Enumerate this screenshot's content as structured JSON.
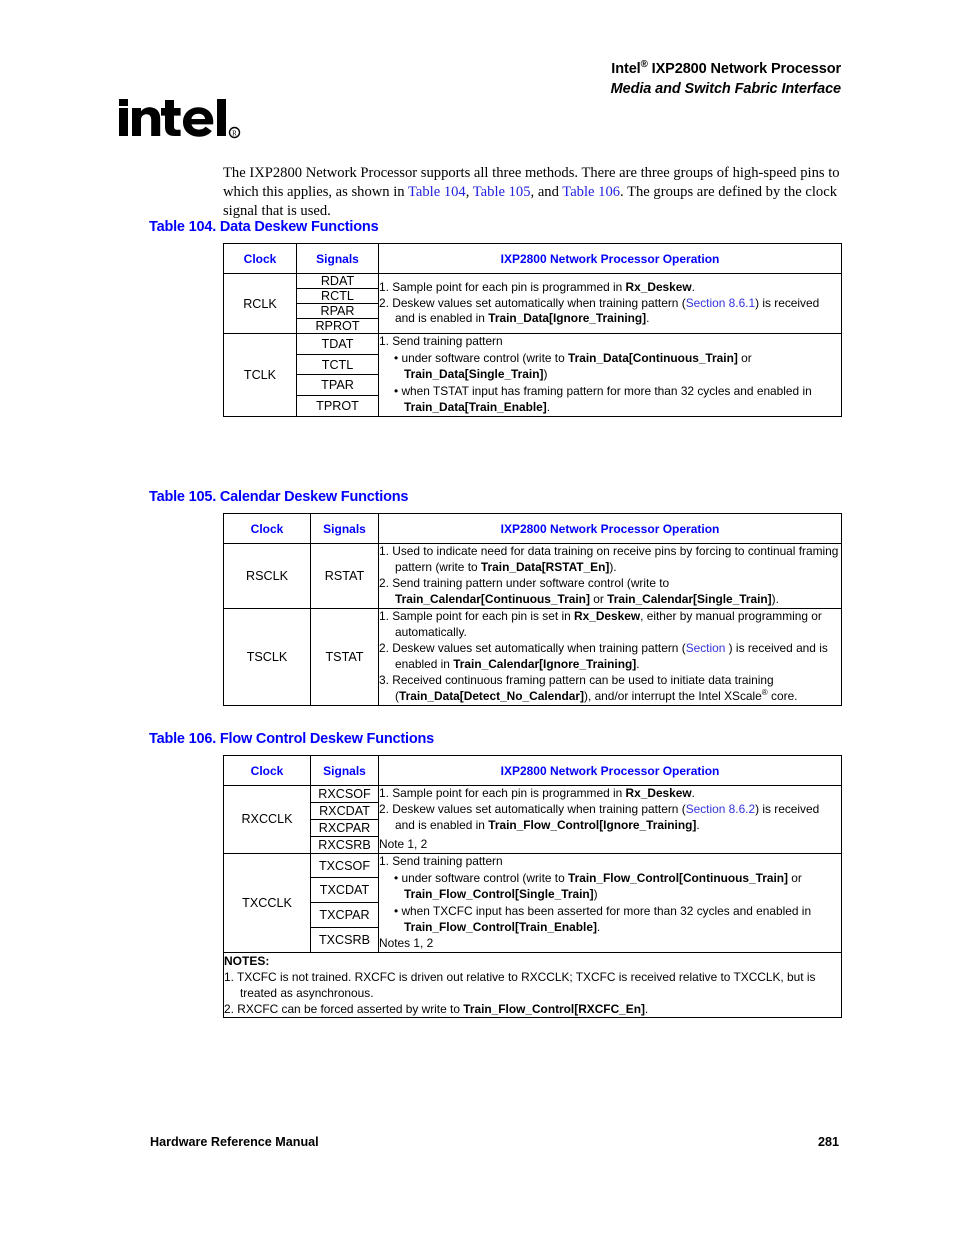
{
  "header": {
    "line1_pre": "Intel",
    "line1_sup": "®",
    "line1_post": " IXP2800 Network Processor",
    "line2": "Media and Switch Fabric Interface",
    "logo_alt": "intel-logo"
  },
  "intro": {
    "seg1": "The IXP2800 Network Processor supports all three methods. There are three groups of high-speed pins to which this applies, as shown in ",
    "link1": "Table 104",
    "sep1": ", ",
    "link2": "Table 105",
    "sep2": ", and ",
    "link3": "Table 106",
    "seg2": ". The groups are defined by the clock signal that is used."
  },
  "columns": {
    "clock": "Clock",
    "signals": "Signals",
    "operation": "IXP2800 Network Processor Operation"
  },
  "table104": {
    "caption": "Table 104. Data Deskew Functions",
    "rows": [
      {
        "clock": "RCLK",
        "signals": [
          "RDAT",
          "RCTL",
          "RPAR",
          "RPROT"
        ],
        "ops": [
          {
            "kind": "num",
            "num": "1.",
            "parts": [
              {
                "t": "Sample point for each pin is programmed in "
              },
              {
                "t": "Rx_Deskew",
                "b": true
              },
              {
                "t": "."
              }
            ]
          },
          {
            "kind": "num",
            "num": "2.",
            "parts": [
              {
                "t": "Deskew values set automatically when training pattern ("
              },
              {
                "t": "Section 8.6.1",
                "link": true
              },
              {
                "t": ") is received and is enabled in "
              },
              {
                "t": "Train_Data[Ignore_Training]",
                "b": true
              },
              {
                "t": "."
              }
            ]
          }
        ]
      },
      {
        "clock": "TCLK",
        "signals": [
          "TDAT",
          "TCTL",
          "TPAR",
          "TPROT"
        ],
        "ops": [
          {
            "kind": "num",
            "num": "1.",
            "parts": [
              {
                "t": "Send training pattern"
              }
            ]
          },
          {
            "kind": "bullet",
            "num": "•",
            "parts": [
              {
                "t": "under software control (write to "
              },
              {
                "t": "Train_Data[Continuous_Train]",
                "b": true
              },
              {
                "t": " or "
              },
              {
                "t": "Train_Data[Single_Train]",
                "b": true
              },
              {
                "t": ")"
              }
            ]
          },
          {
            "kind": "bullet",
            "num": "•",
            "parts": [
              {
                "t": "when TSTAT input has framing pattern for more than 32 cycles and enabled in "
              },
              {
                "t": "Train_Data[Train_Enable]",
                "b": true
              },
              {
                "t": "."
              }
            ]
          }
        ]
      }
    ]
  },
  "table105": {
    "caption": "Table 105. Calendar Deskew Functions",
    "rows": [
      {
        "clock": "RSCLK",
        "signals": [
          "RSTAT"
        ],
        "ops": [
          {
            "kind": "num",
            "num": "1.",
            "parts": [
              {
                "t": "Used to indicate need for data training on receive pins by forcing to continual framing pattern (write to "
              },
              {
                "t": "Train_Data[RSTAT_En]",
                "b": true
              },
              {
                "t": ")."
              }
            ]
          },
          {
            "kind": "num",
            "num": "2.",
            "parts": [
              {
                "t": "Send training pattern under software control (write to "
              },
              {
                "t": "Train_Calendar[Continuous_Train]",
                "b": true
              },
              {
                "t": " or "
              },
              {
                "t": "Train_Calendar[Single_Train]",
                "b": true
              },
              {
                "t": ")."
              }
            ]
          }
        ]
      },
      {
        "clock": "TSCLK",
        "signals": [
          "TSTAT"
        ],
        "ops": [
          {
            "kind": "num",
            "num": "1.",
            "parts": [
              {
                "t": "Sample point for each pin is set in "
              },
              {
                "t": "Rx_Deskew",
                "b": true
              },
              {
                "t": ", either by manual programming or automatically."
              }
            ]
          },
          {
            "kind": "num",
            "num": "2.",
            "parts": [
              {
                "t": "Deskew values set automatically when training pattern ("
              },
              {
                "t": "Section",
                "link": true
              },
              {
                "t": " ) is received and is enabled in "
              },
              {
                "t": "Train_Calendar[Ignore_Training]",
                "b": true
              },
              {
                "t": "."
              }
            ]
          },
          {
            "kind": "num",
            "num": "3.",
            "parts": [
              {
                "t": "Received continuous framing pattern can be used to initiate data training ("
              },
              {
                "t": "Train_Data[Detect_No_Calendar]",
                "b": true
              },
              {
                "t": "), and/or interrupt the Intel XScale"
              },
              {
                "t": "®",
                "sup": true
              },
              {
                "t": " core."
              }
            ]
          }
        ]
      }
    ]
  },
  "table106": {
    "caption": "Table 106. Flow Control Deskew Functions",
    "rows": [
      {
        "clock": "RXCCLK",
        "signals": [
          "RXCSOF",
          "RXCDAT",
          "RXCPAR",
          "RXCSRB"
        ],
        "ops": [
          {
            "kind": "num",
            "num": "1.",
            "parts": [
              {
                "t": "Sample point for each pin is programmed in "
              },
              {
                "t": "Rx_Deskew",
                "b": true
              },
              {
                "t": "."
              }
            ]
          },
          {
            "kind": "num",
            "num": "2.",
            "parts": [
              {
                "t": "Deskew values set automatically when training pattern ("
              },
              {
                "t": "Section 8.6.2",
                "link": true
              },
              {
                "t": ") is received and is enabled in "
              },
              {
                "t": "Train_Flow_Control[Ignore_Training]",
                "b": true
              },
              {
                "t": "."
              }
            ]
          },
          {
            "kind": "plain",
            "gap": true,
            "parts": [
              {
                "t": "Note 1, 2"
              }
            ]
          }
        ]
      },
      {
        "clock": "TXCCLK",
        "signals": [
          "TXCSOF",
          "TXCDAT",
          "TXCPAR",
          "TXCSRB"
        ],
        "ops": [
          {
            "kind": "num",
            "num": "1.",
            "parts": [
              {
                "t": "Send training pattern"
              }
            ]
          },
          {
            "kind": "bullet",
            "num": "•",
            "parts": [
              {
                "t": "under software control (write to "
              },
              {
                "t": "Train_Flow_Control[Continuous_Train]",
                "b": true
              },
              {
                "t": " or "
              },
              {
                "t": "Train_Flow_Control[Single_Train]",
                "b": true
              },
              {
                "t": ")"
              }
            ]
          },
          {
            "kind": "bullet",
            "num": "•",
            "parts": [
              {
                "t": "when TXCFC input has been asserted for more than 32 cycles and enabled in "
              },
              {
                "t": "Train_Flow_Control[Train_Enable]",
                "b": true
              },
              {
                "t": "."
              }
            ]
          },
          {
            "kind": "plain",
            "parts": [
              {
                "t": "Notes 1, 2"
              }
            ]
          }
        ]
      }
    ],
    "notes": {
      "title": "NOTES:",
      "items": [
        {
          "num": "1.",
          "parts": [
            {
              "t": "TXCFC is not trained. RXCFC is driven out relative to RXCCLK; TXCFC is received relative to TXCCLK, but is treated as asynchronous."
            }
          ]
        },
        {
          "num": "2.",
          "parts": [
            {
              "t": "RXCFC can be forced asserted by write to "
            },
            {
              "t": "Train_Flow_Control[RXCFC_En]",
              "b": true
            },
            {
              "t": "."
            }
          ]
        }
      ]
    }
  },
  "footer": {
    "left": "Hardware Reference Manual",
    "page": "281"
  }
}
